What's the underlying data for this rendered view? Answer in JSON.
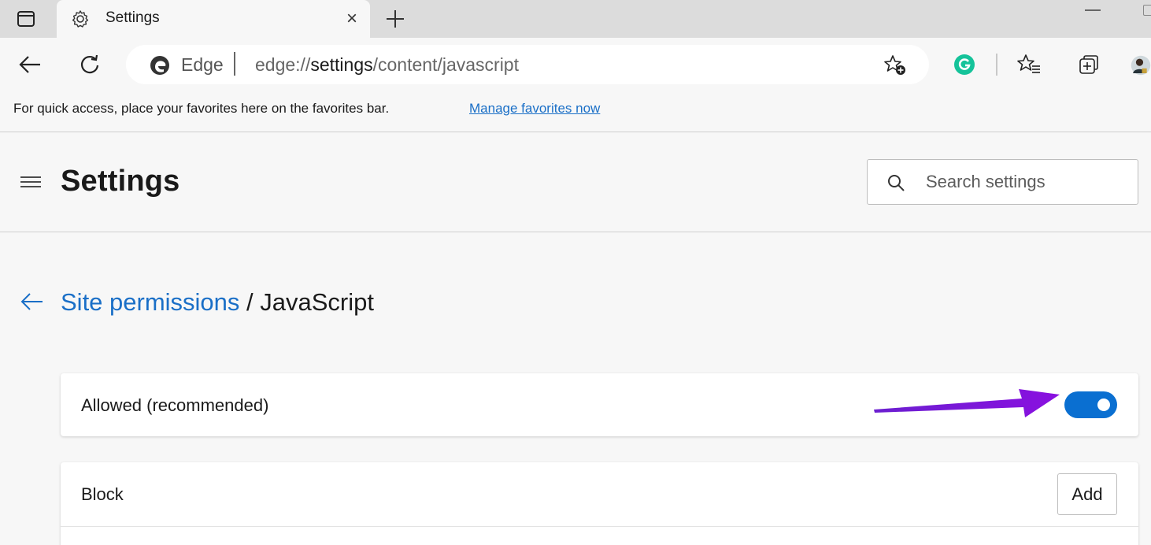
{
  "tab": {
    "title": "Settings",
    "close_glyph": "×"
  },
  "window_controls": {
    "minimize_glyph": "—"
  },
  "toolbar": {
    "edge_label": "Edge",
    "url_scheme": "edge://",
    "url_host": "settings",
    "url_path": "/content/javascript"
  },
  "favorites_bar": {
    "message": "For quick access, place your favorites here on the favorites bar.",
    "link": "Manage favorites now"
  },
  "settings": {
    "title": "Settings",
    "search_placeholder": "Search settings"
  },
  "breadcrumb": {
    "parent": "Site permissions",
    "separator": " / ",
    "current": "JavaScript"
  },
  "allowed": {
    "label": "Allowed (recommended)",
    "enabled": true
  },
  "block": {
    "label": "Block",
    "add_label": "Add"
  },
  "icons": {
    "tab_actions": "tab-actions-icon",
    "tab_favicon": "gear-icon",
    "new_tab": "plus-icon",
    "back": "back-arrow-icon",
    "refresh": "refresh-icon",
    "edge_logo": "edge-logo-icon",
    "add_favorite": "add-favorite-icon",
    "grammarly": "grammarly-icon",
    "favorites": "favorites-icon",
    "collections": "collections-icon",
    "profile": "profile-avatar-icon",
    "menu": "hamburger-menu-icon",
    "search": "search-icon",
    "breadcrumb_back": "back-arrow-icon"
  },
  "colors": {
    "accent": "#1a6fc7",
    "toggle_on": "#0a6fd1",
    "grammarly": "#15c39a",
    "annotation_arrow": "#7b18d8"
  }
}
